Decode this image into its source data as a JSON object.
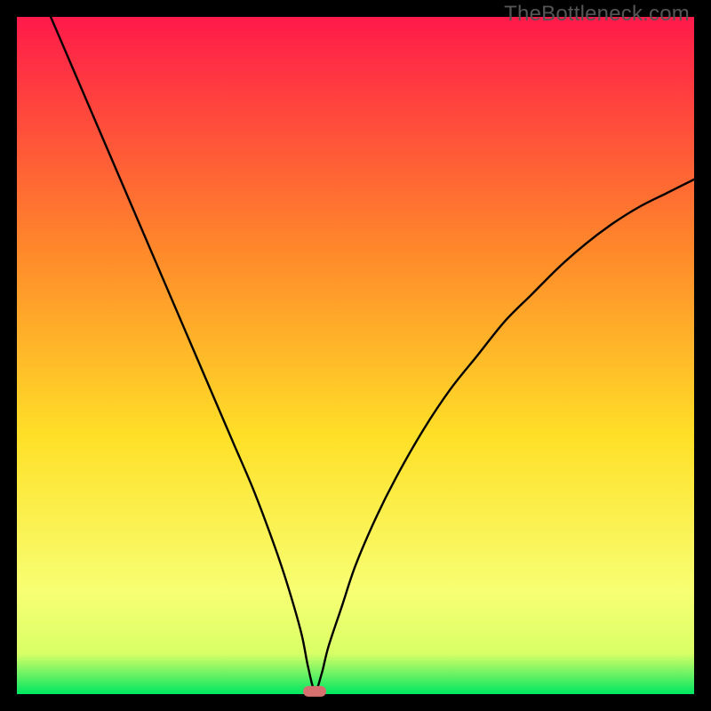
{
  "watermark": "TheBottleneck.com",
  "colors": {
    "gradient_top": "#ff1a4a",
    "gradient_mid_upper": "#ff8a2a",
    "gradient_mid": "#ffe028",
    "gradient_lower": "#f7ff73",
    "gradient_band": "#d9ff66",
    "gradient_bottom": "#00e661",
    "curve": "#000000",
    "marker": "#d6706f",
    "frame": "#000000"
  },
  "chart_data": {
    "type": "line",
    "title": "",
    "xlabel": "",
    "ylabel": "",
    "xlim": [
      0,
      100
    ],
    "ylim": [
      0,
      100
    ],
    "grid": false,
    "legend": false,
    "optimum_x": 44,
    "marker": {
      "x": 44,
      "y": 0.4,
      "w": 3.4,
      "h": 1.6
    },
    "series": [
      {
        "name": "bottleneck-curve",
        "x": [
          5,
          8,
          11,
          14,
          17,
          20,
          23,
          26,
          29,
          32,
          35,
          38,
          40,
          42,
          43,
          44,
          45,
          46,
          48,
          50,
          53,
          56,
          60,
          64,
          68,
          72,
          76,
          80,
          84,
          88,
          92,
          96,
          100
        ],
        "y": [
          100,
          93,
          86,
          79,
          72,
          65,
          58,
          51,
          44,
          37,
          30,
          22,
          16,
          9,
          4,
          0.5,
          3,
          7,
          13,
          19,
          26,
          32,
          39,
          45,
          50,
          55,
          59,
          63,
          66.5,
          69.5,
          72,
          74,
          76
        ]
      }
    ]
  }
}
